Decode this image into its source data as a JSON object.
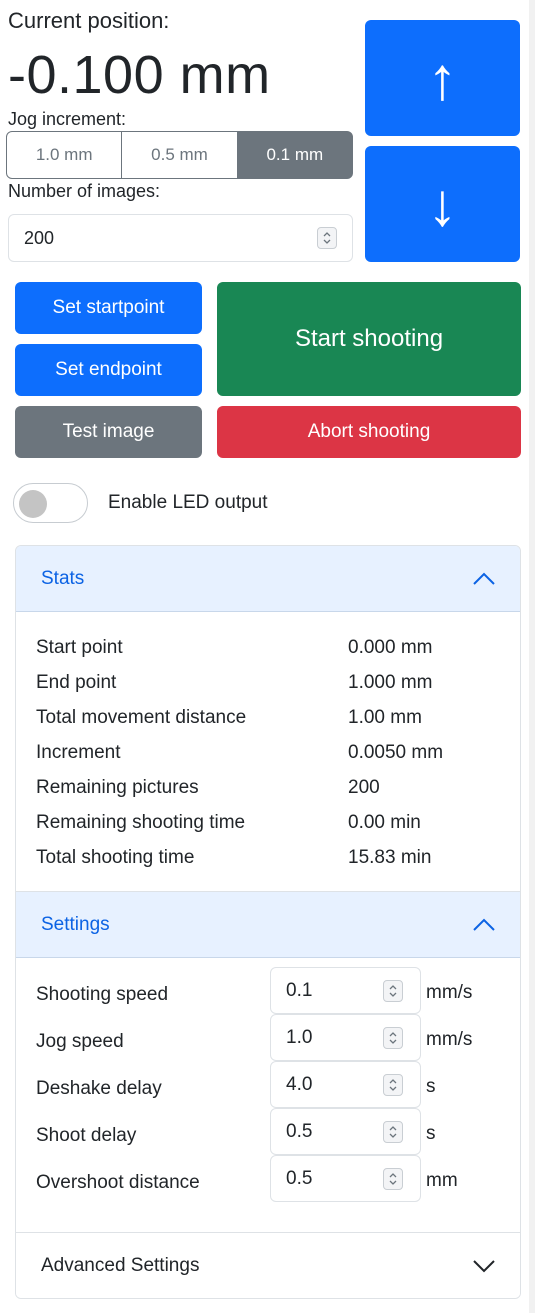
{
  "position": {
    "label": "Current position:",
    "value": "-0.100 mm"
  },
  "jog": {
    "label": "Jog increment:",
    "options": [
      "1.0 mm",
      "0.5 mm",
      "0.1 mm"
    ],
    "selected": "0.1 mm"
  },
  "images": {
    "label": "Number of images:",
    "value": "200"
  },
  "jog_buttons": {
    "up": "↑",
    "down": "↓"
  },
  "actions": {
    "set_startpoint": "Set startpoint",
    "set_endpoint": "Set endpoint",
    "test_image": "Test image",
    "start_shooting": "Start shooting",
    "abort_shooting": "Abort shooting"
  },
  "led": {
    "label": "Enable LED output",
    "enabled": false
  },
  "stats": {
    "title": "Stats",
    "rows": [
      {
        "label": "Start point",
        "value": "0.000 mm"
      },
      {
        "label": "End point",
        "value": "1.000 mm"
      },
      {
        "label": "Total movement distance",
        "value": "1.00 mm"
      },
      {
        "label": "Increment",
        "value": "0.0050 mm"
      },
      {
        "label": "Remaining pictures",
        "value": "200"
      },
      {
        "label": "Remaining shooting time",
        "value": "0.00 min"
      },
      {
        "label": "Total shooting time",
        "value": "15.83 min"
      }
    ]
  },
  "settings": {
    "title": "Settings",
    "rows": [
      {
        "label": "Shooting speed",
        "value": "0.1",
        "unit": "mm/s"
      },
      {
        "label": "Jog speed",
        "value": "1.0",
        "unit": "mm/s"
      },
      {
        "label": "Deshake delay",
        "value": "4.0",
        "unit": "s"
      },
      {
        "label": "Shoot delay",
        "value": "0.5",
        "unit": "s"
      },
      {
        "label": "Overshoot distance",
        "value": "0.5",
        "unit": "mm"
      }
    ]
  },
  "advanced": {
    "title": "Advanced Settings"
  },
  "colors": {
    "primary": "#0d6efd",
    "success": "#198754",
    "secondary": "#6c757d",
    "danger": "#dc3545",
    "accordion_active_bg": "#e7f1ff",
    "accordion_active_text": "#0c63e4"
  }
}
